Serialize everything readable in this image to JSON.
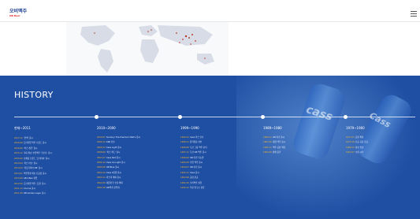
{
  "header": {
    "logo_ko": "오비맥주",
    "logo_en": "OB Beer",
    "menu_icon": "hamburger-menu-icon"
  },
  "history": {
    "title": "HISTORY",
    "columns": [
      {
        "period": "현재~2011",
        "entries": [
          {
            "year": "2017.12",
            "text": "'한맥' 출시"
          },
          {
            "year": "2016.08",
            "text": "프리미엄 맥주 브랜드 출시"
          },
          {
            "year": "2016.06",
            "text": "'카스 레몬' 출시"
          },
          {
            "year": "2015.12",
            "text": "국내 최초 수입맥주 '코로나' 출시"
          },
          {
            "year": "2015.06",
            "text": "신제품 브랜드 '프리미어' 출시"
          },
          {
            "year": "2014.09",
            "text": "'카스 비츠' 출시"
          },
          {
            "year": "2014.04",
            "text": "'더프리미어 OB' 출시"
          },
          {
            "year": "2014.01",
            "text": "맥주업계 최초 신공장 출시"
          },
          {
            "year": "2013.08",
            "text": "AB InBev 편입"
          },
          {
            "year": "2012.06",
            "text": "프리미엄 맥주 '프림' 출시"
          },
          {
            "year": "2011.12",
            "text": "Corona 출시"
          },
          {
            "year": "2011.08",
            "text": "OB Golden Lager 출시"
          }
        ]
      },
      {
        "period": "2010~2000",
        "entries": [
          {
            "year": "2010.07",
            "text": "Sunbury The Premium Malt's 출시"
          },
          {
            "year": "2009.12",
            "text": "KKR 인수"
          },
          {
            "year": "2008.12",
            "text": "Cass Light 출시"
          },
          {
            "year": "2008.06",
            "text": "'카스 레드' 출시"
          },
          {
            "year": "2007.07",
            "text": "Cass Red 출시"
          },
          {
            "year": "2006.10",
            "text": "Cass Ice Light 출시"
          },
          {
            "year": "2005.08",
            "text": "OB Blue 출시"
          },
          {
            "year": "2004.10",
            "text": "Cass 2만원 출시"
          },
          {
            "year": "2003.11",
            "text": "카스의 해외 출시"
          },
          {
            "year": "2002.09",
            "text": "대한민국 수출 확대"
          },
          {
            "year": "2001.08",
            "text": "OB맥주 음악회"
          }
        ]
      },
      {
        "period": "1999~1990",
        "entries": [
          {
            "year": "1999.12",
            "text": "Cass 카스 인수"
          },
          {
            "year": "1998.11",
            "text": "원가절감 선언"
          },
          {
            "year": "1998.06",
            "text": "두산 그룹 맥주 분리"
          },
          {
            "year": "1997.11",
            "text": "두산 OB 맥주 출시"
          },
          {
            "year": "1996.09",
            "text": "OB 라거 리뉴얼"
          },
          {
            "year": "1995.08",
            "text": "수입 맥주 출시"
          },
          {
            "year": "1994.07",
            "text": "OB 라거 출시"
          },
          {
            "year": "1993.11",
            "text": "Cass 출시"
          },
          {
            "year": "1992.08",
            "text": "공장 준공"
          },
          {
            "year": "1991.05",
            "text": "오비맥주 설립"
          },
          {
            "year": "1990.12",
            "text": "주류 연구소 설립"
          }
        ]
      },
      {
        "period": "1989~1980",
        "entries": [
          {
            "year": "1989.12",
            "text": "OB 라거 출시"
          },
          {
            "year": "1987.06",
            "text": "대형 맥주 출시"
          },
          {
            "year": "1985.11",
            "text": "맥주 공장 확장"
          },
          {
            "year": "1984.08",
            "text": "판매 증가"
          }
        ]
      },
      {
        "period": "1979~1960",
        "entries": [
          {
            "year": "1977.03",
            "text": "공장 확장"
          },
          {
            "year": "1973.10",
            "text": "신규 공장 준공"
          },
          {
            "year": "1968.12",
            "text": "상호 변경"
          },
          {
            "year": "1962.07",
            "text": "수출 시작"
          }
        ]
      }
    ]
  },
  "background": {
    "can_label_1": "cass",
    "can_label_2": "Cass"
  }
}
